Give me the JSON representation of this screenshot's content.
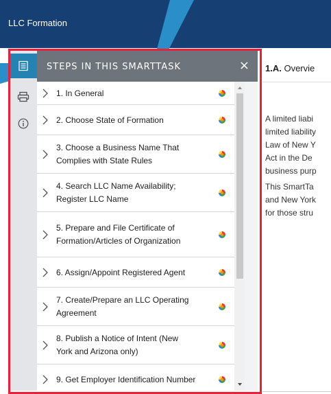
{
  "header": {
    "title": "LLC Formation"
  },
  "panel": {
    "title": "STEPS IN THIS SMARTTASK",
    "close_label": "×"
  },
  "rail": {
    "items": [
      {
        "icon": "list-icon",
        "active": true
      },
      {
        "icon": "print-icon",
        "active": false
      },
      {
        "icon": "info-icon",
        "active": false
      }
    ]
  },
  "steps": [
    {
      "lines": [
        "1. In General"
      ]
    },
    {
      "lines": [
        "2. Choose State of Formation"
      ]
    },
    {
      "lines": [
        "3. Choose a Business Name That",
        "Complies with State Rules"
      ]
    },
    {
      "lines": [
        "4. Search LLC Name Availability;",
        "Register LLC Name"
      ]
    },
    {
      "lines": [
        "5. Prepare and File Certificate of",
        "Formation/Articles of Organization"
      ]
    },
    {
      "lines": [
        "6. Assign/Appoint Registered Agent"
      ]
    },
    {
      "lines": [
        "7. Create/Prepare an LLC Operating",
        "Agreement"
      ]
    },
    {
      "lines": [
        "8. Publish a Notice of Intent (New",
        "York and Arizona only)"
      ]
    },
    {
      "lines": [
        "9. Get Employer Identification Number"
      ]
    }
  ],
  "content": {
    "section_number": "1.A.",
    "section_title": "Overvie",
    "paragraph1": [
      "A limited liabi",
      "limited liability",
      "Law of New Y",
      "Act in the De",
      "business purp"
    ],
    "paragraph2": [
      "This SmartTa",
      "and New York",
      "for those stru"
    ]
  },
  "colors": {
    "header_bg": "#163f73",
    "callout": "#2a8fc9",
    "highlight_frame": "#e8203a",
    "panel_head": "#6d747b",
    "rail_active": "#2583b3"
  }
}
